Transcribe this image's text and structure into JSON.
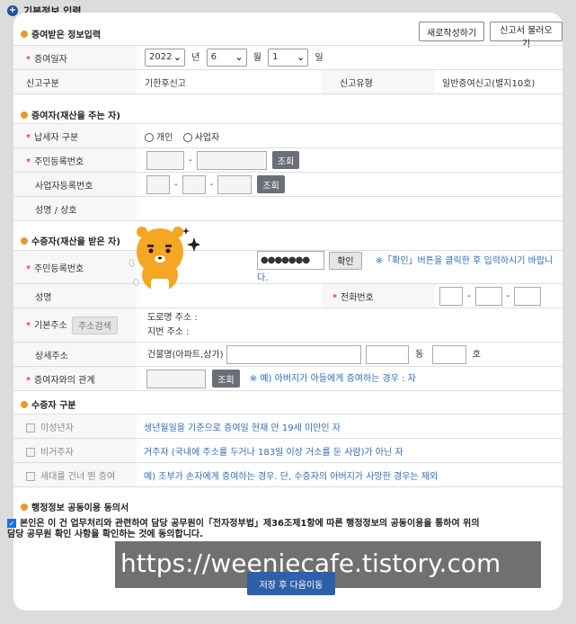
{
  "header": {
    "title": "기본정보 입력"
  },
  "sections": {
    "received_info": "증여받은 정보입력",
    "donor": "증여자(재산을 주는 자)",
    "donee": "수증자(재산을 받은 자)",
    "donee_type": "수증자 구분",
    "consent": "행정정보 공동이용 동의서"
  },
  "toolbar": {
    "new_label": "새로작성하기",
    "load_label": "신고서 불러오기"
  },
  "gift_date": {
    "label": "증여일자",
    "year": "2022",
    "year_unit": "년",
    "month": "6",
    "month_unit": "월",
    "day": "1",
    "day_unit": "일"
  },
  "report": {
    "type_label": "신고구분",
    "type_value": "기한후신고",
    "kind_label": "신고유형",
    "kind_value": "일반증여신고(별지10호)"
  },
  "donor": {
    "taxpayer_label": "납세자 구분",
    "opt_individual": "개인",
    "opt_business": "사업자",
    "rrn_label": "주민등록번호",
    "brn_label": "사업자등록번호",
    "name_label": "성명 / 상호",
    "lookup": "조회"
  },
  "donee": {
    "rrn_label": "주민등록번호",
    "rrn_masked": "●●●●●●●",
    "confirm_btn": "확인",
    "confirm_hint": "※「확인」버튼을 클릭한 후 입력하시기 바랍니다.",
    "name_label": "성명",
    "phone_label": "전화번호",
    "addr_label": "기본주소",
    "addr_search": "주소검색",
    "road_addr": "도로명 주소 :",
    "lot_addr": "지번 주소 :",
    "detail_label": "상세주소",
    "building_label": "건물명(아파트,상가)",
    "dong": "동",
    "ho": "호",
    "relation_label": "증여자와의 관계",
    "lookup": "조회",
    "relation_hint": "※ 예) 아버지가 아들에게 증여하는 경우 : 자"
  },
  "donee_types": [
    {
      "label": "미성년자",
      "desc": "생년월일을 기준으로 증여일 현재 만 19세 미만인 자"
    },
    {
      "label": "비거주자",
      "desc": "거주자 (국내에 주소를 두거나 183일 이상 거소를 둔 사람)가 아닌 자"
    },
    {
      "label": "세대를 건너 뛴 증여",
      "desc": "예) 조부가 손자에게 증여하는 경우. 단, 수증자의 아버지가 사망한 경우는 제외"
    }
  ],
  "consent_text_1": "본인은 이 건 업무처리와 관련하여 담당 공무원이「전자정부법」제36조제1항에 따른 행정정보의 공동이용을 통하여 위의",
  "consent_text_2": "담당 공무원 확인 사항을 확인하는 것에 동의합니다.",
  "watermark": "https://weeniecafe.tistory.com",
  "save_label": "저장 후 다음이동",
  "colors": {
    "accent": "#2f5fa8",
    "required": "#d0021b",
    "hint": "#2f6db5",
    "bullet": "#e99a2c"
  }
}
